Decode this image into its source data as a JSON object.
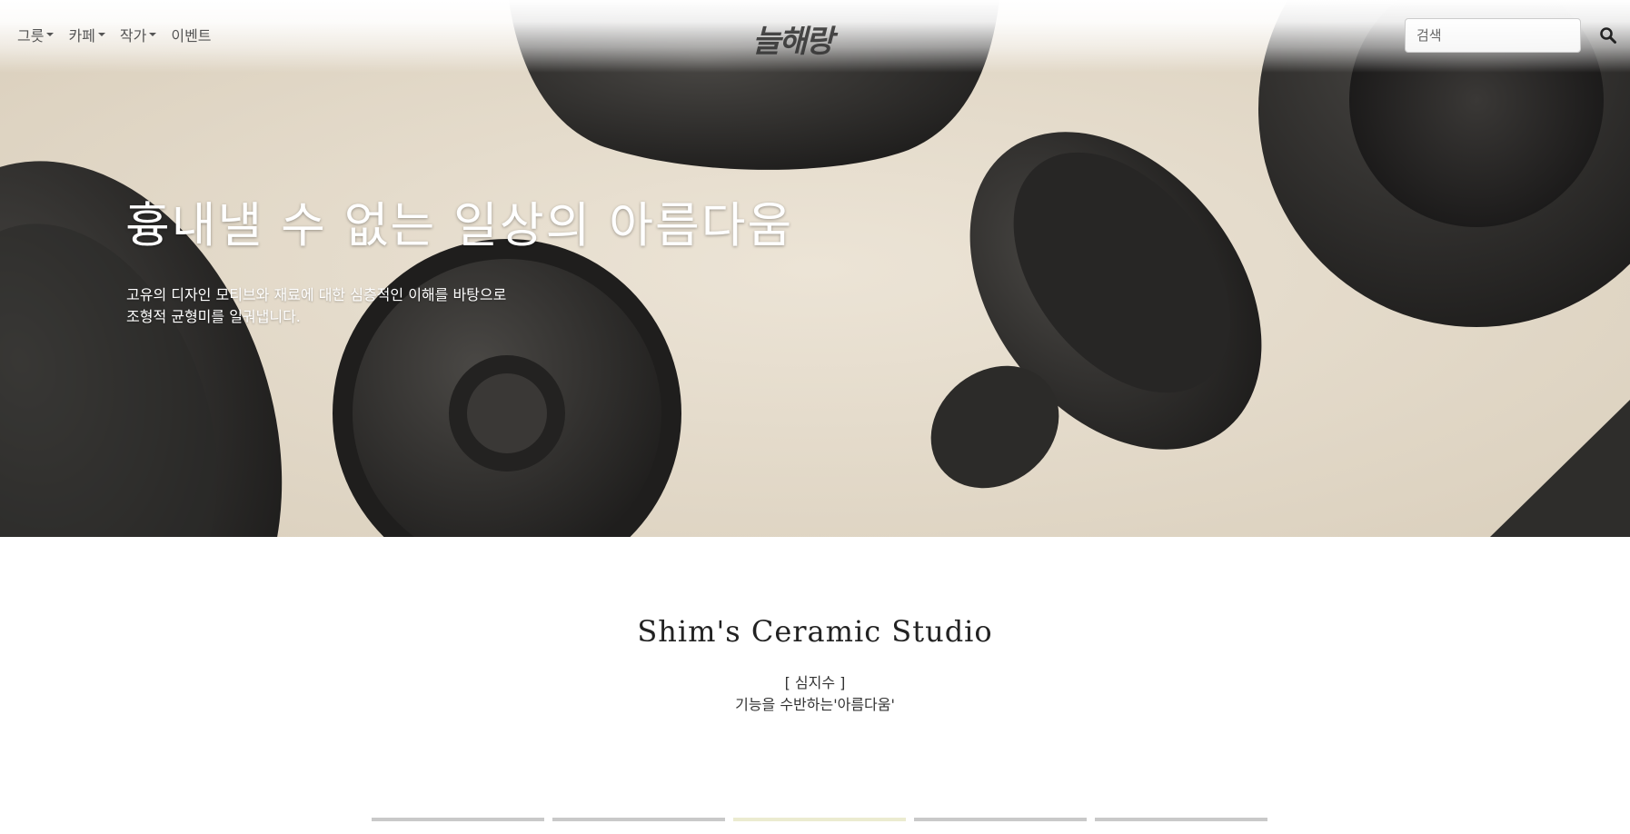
{
  "nav": {
    "menu": [
      {
        "label": "그릇",
        "has_dropdown": true
      },
      {
        "label": "카페",
        "has_dropdown": true
      },
      {
        "label": "작가",
        "has_dropdown": true
      },
      {
        "label": "이벤트",
        "has_dropdown": false
      }
    ],
    "logo_text": "늘해랑",
    "search_placeholder": "검색"
  },
  "hero": {
    "title": "흉내낼 수 없는 일상의 아름다움",
    "desc_line1": "고유의 디자인 모티브와 재료에 대한 심층적인 이해를 바탕으로",
    "desc_line2": "조형적 균형미를 일궈냅니다."
  },
  "studio": {
    "title": "Shim's Ceramic Studio",
    "artist": "[ 심지수 ]",
    "motto": "기능을 수반하는'아름다움'"
  },
  "tabs": {
    "count": 5,
    "active_index": 2
  },
  "colors": {
    "hero_background": "#e2d8c8",
    "ceramic": "#2b2a28",
    "tab_inactive": "#c9c9c9",
    "tab_active": "#ebebd0"
  }
}
